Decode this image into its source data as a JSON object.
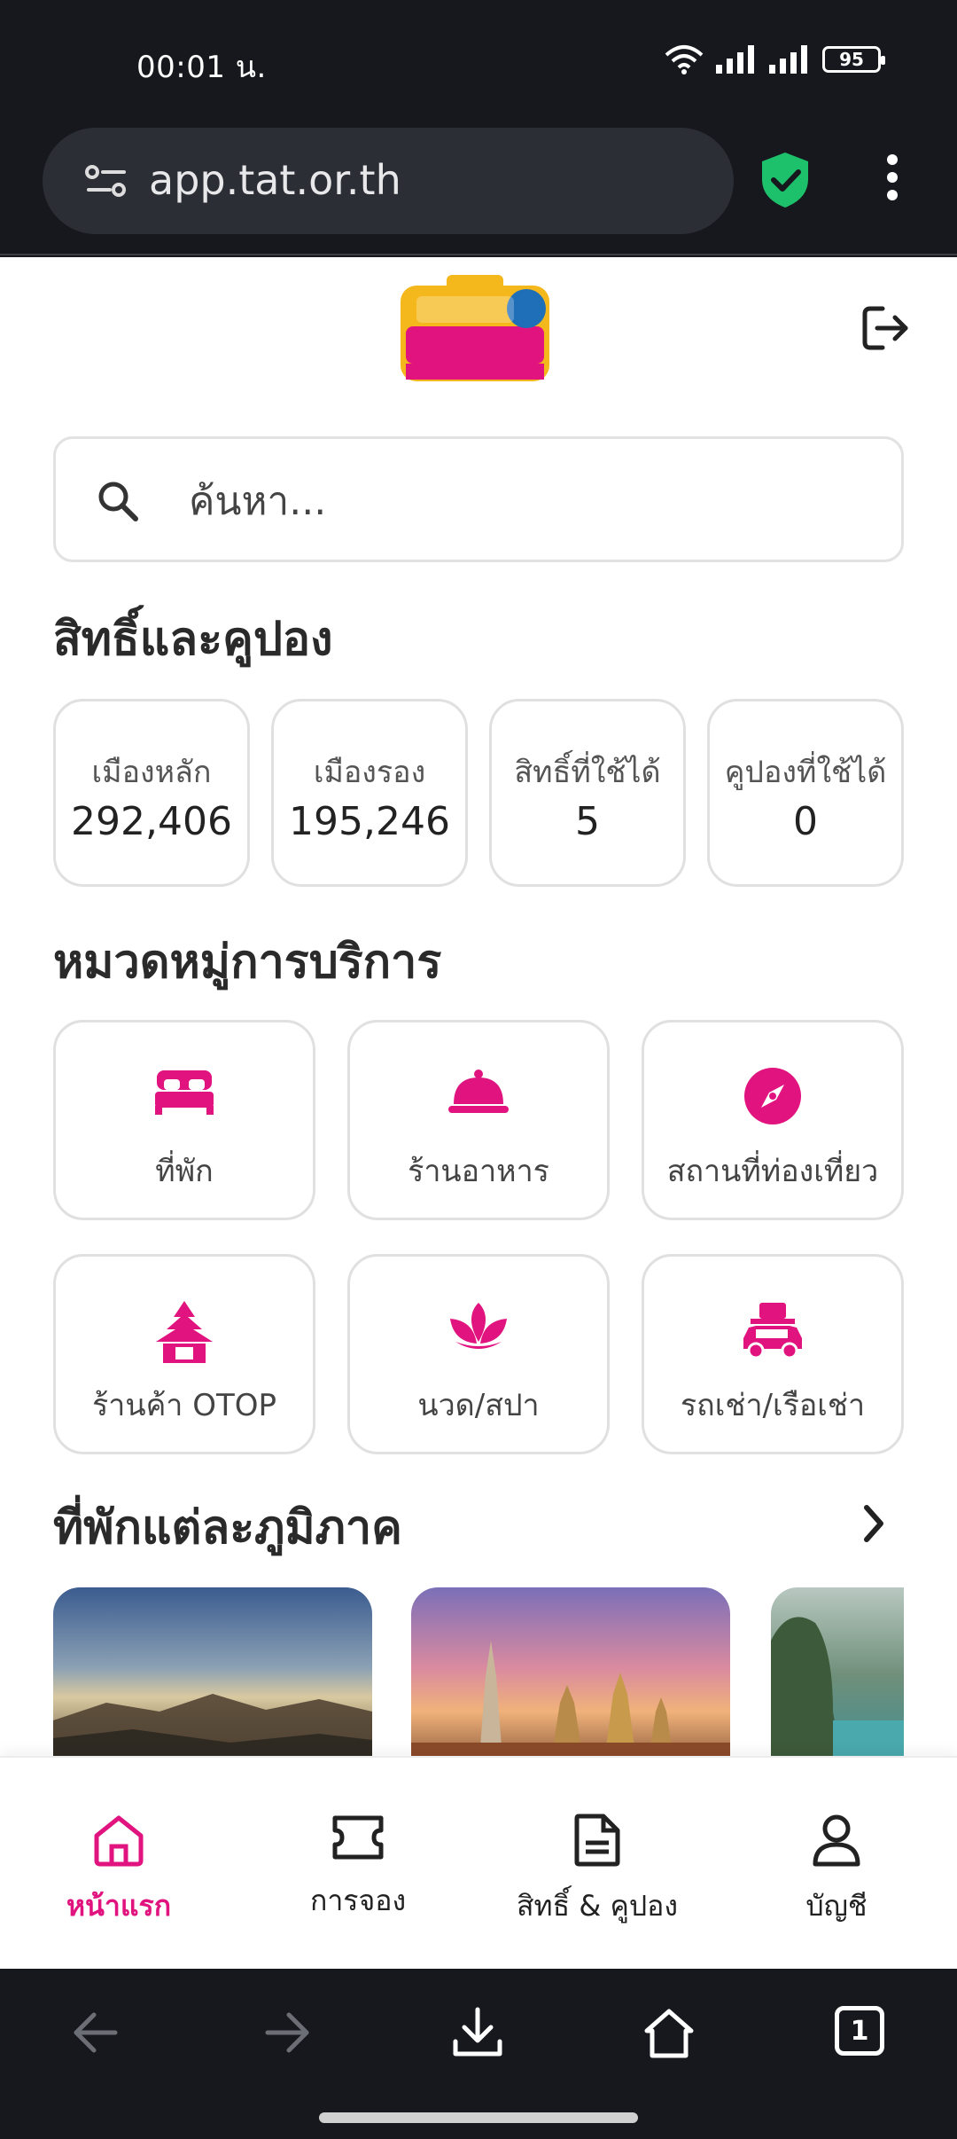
{
  "status_bar": {
    "time": "00:01 น.",
    "battery": "95"
  },
  "browser": {
    "url": "app.tat.or.th"
  },
  "header": {
    "logo_alt": "เที่ยวไทยคนละครึ่ง"
  },
  "search": {
    "placeholder": "ค้นหา..."
  },
  "rights_section": {
    "title": "สิทธิ์และคูปอง",
    "cards": [
      {
        "label": "เมืองหลัก",
        "value": "292,406"
      },
      {
        "label": "เมืองรอง",
        "value": "195,246"
      },
      {
        "label": "สิทธิ์ที่ใช้ได้",
        "value": "5"
      },
      {
        "label": "คูปองที่ใช้ได้",
        "value": "0"
      }
    ]
  },
  "category_section": {
    "title": "หมวดหมู่การบริการ",
    "items": [
      {
        "label": "ที่พัก",
        "icon": "bed-icon"
      },
      {
        "label": "ร้านอาหาร",
        "icon": "food-cloche-icon"
      },
      {
        "label": "สถานที่ท่องเที่ยว",
        "icon": "compass-icon"
      },
      {
        "label": "ร้านค้า OTOP",
        "icon": "thai-pavilion-icon"
      },
      {
        "label": "นวด/สปา",
        "icon": "lotus-icon"
      },
      {
        "label": "รถเช่า/เรือเช่า",
        "icon": "car-luggage-icon"
      }
    ]
  },
  "region_section": {
    "title": "ที่พักแต่ละภูมิภาค"
  },
  "bottom_nav": [
    {
      "label": "หน้าแรก",
      "icon": "home-icon",
      "active": true
    },
    {
      "label": "การจอง",
      "icon": "ticket-icon",
      "active": false
    },
    {
      "label": "สิทธิ์ & คูปอง",
      "icon": "document-icon",
      "active": false
    },
    {
      "label": "บัญชี",
      "icon": "user-icon",
      "active": false
    }
  ],
  "browser_toolbar": {
    "tab_count": "1"
  },
  "colors": {
    "accent": "#e0137f",
    "dark_bar": "#16181d",
    "shield": "#1ec16b"
  }
}
